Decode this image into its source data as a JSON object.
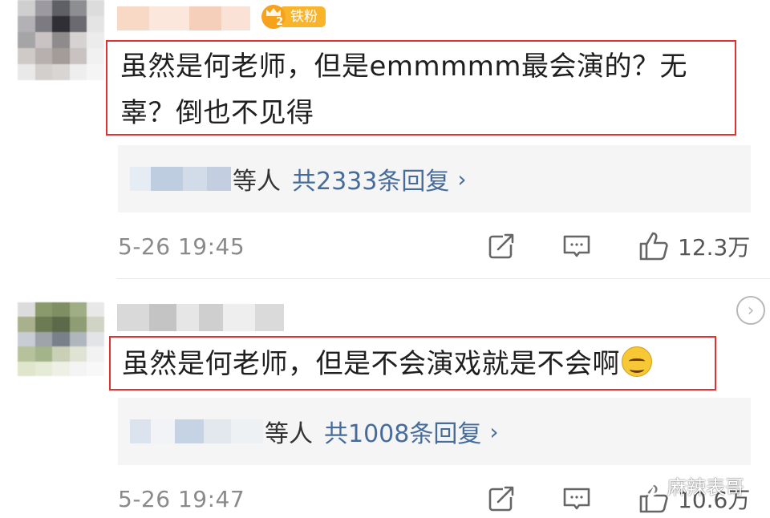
{
  "comments": [
    {
      "badge": {
        "level": "2",
        "label": "铁粉"
      },
      "text": "虽然是何老师，但是emmmmm最会演的？无辜？倒也不见得",
      "text_line1": "虽然是何老师，但是emmmmm最会演的？无",
      "text_line2": "辜？倒也不见得",
      "replies": {
        "etc": "等人",
        "count": "共2333条回复",
        "chevron": "›"
      },
      "time": "5-26 19:45",
      "likes": "12.3万"
    },
    {
      "text": "虽然是何老师，但是不会演戏就是不会啊",
      "emoji": "sweat-smile-emoji",
      "replies": {
        "etc": "等人",
        "count": "共1008条回复",
        "chevron": "›"
      },
      "time": "5-26 19:47",
      "likes": "10.6万"
    }
  ],
  "watermark": {
    "text": "麻辣表哥",
    "icon": "wechat-icon"
  },
  "icons": {
    "share": "share-icon",
    "comment": "comment-icon",
    "like": "thumbs-up-icon",
    "more": "chevron-right-circle-icon"
  },
  "colors": {
    "highlight_frame": "#e3312f",
    "reply_link": "#466c9b",
    "badge": "#f8b52c",
    "timestamp": "#8a8a8a"
  }
}
